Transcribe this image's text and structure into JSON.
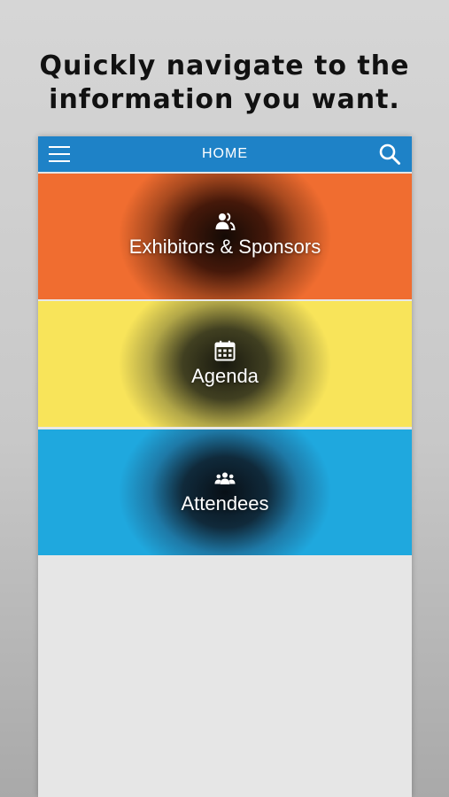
{
  "headline": {
    "line1": "Quickly navigate to the",
    "line2": "information you want."
  },
  "navbar": {
    "title": "HOME",
    "menu_icon": "hamburger-menu-icon",
    "search_icon": "search-icon",
    "color": "#1e82c7"
  },
  "tiles": [
    {
      "label": "Exhibitors & Sponsors",
      "icon": "people-icon",
      "color": "#f06d30"
    },
    {
      "label": "Agenda",
      "icon": "calendar-icon",
      "color": "#f8e45a"
    },
    {
      "label": "Attendees",
      "icon": "group-icon",
      "color": "#1fa8de"
    }
  ]
}
